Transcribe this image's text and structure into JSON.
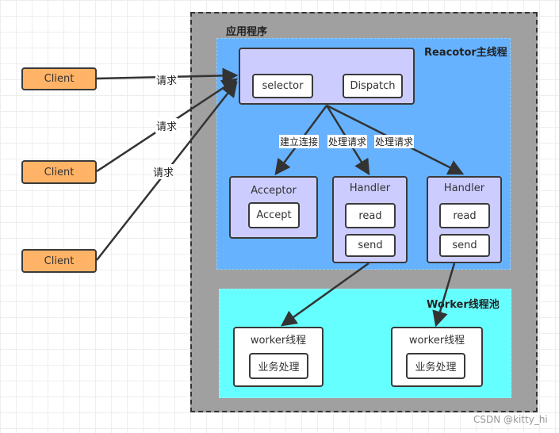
{
  "app": {
    "title": "应用程序"
  },
  "reactor": {
    "title": "Reacotor主线程",
    "selector": "selector",
    "dispatch": "Dispatch"
  },
  "edge_labels": {
    "connect": "建立连接",
    "handle1": "处理请求",
    "handle2": "处理请求"
  },
  "acceptor": {
    "title": "Acceptor",
    "action": "Accept"
  },
  "handlers": [
    {
      "title": "Handler",
      "read": "read",
      "send": "send"
    },
    {
      "title": "Handler",
      "read": "read",
      "send": "send"
    }
  ],
  "worker_pool": {
    "title": "Worker线程池",
    "workers": [
      {
        "title": "worker线程",
        "task": "业务处理"
      },
      {
        "title": "worker线程",
        "task": "业务处理"
      }
    ]
  },
  "clients": [
    {
      "label": "Client",
      "request": "请求"
    },
    {
      "label": "Client",
      "request": "请求"
    },
    {
      "label": "Client",
      "request": "请求"
    }
  ],
  "watermark": "CSDN @kitty_hi",
  "colors": {
    "client": "#ffb366",
    "app": "#a0a0a0",
    "reactor": "#66b2ff",
    "purple": "#ccccff",
    "worker_pool": "#66ffff"
  }
}
